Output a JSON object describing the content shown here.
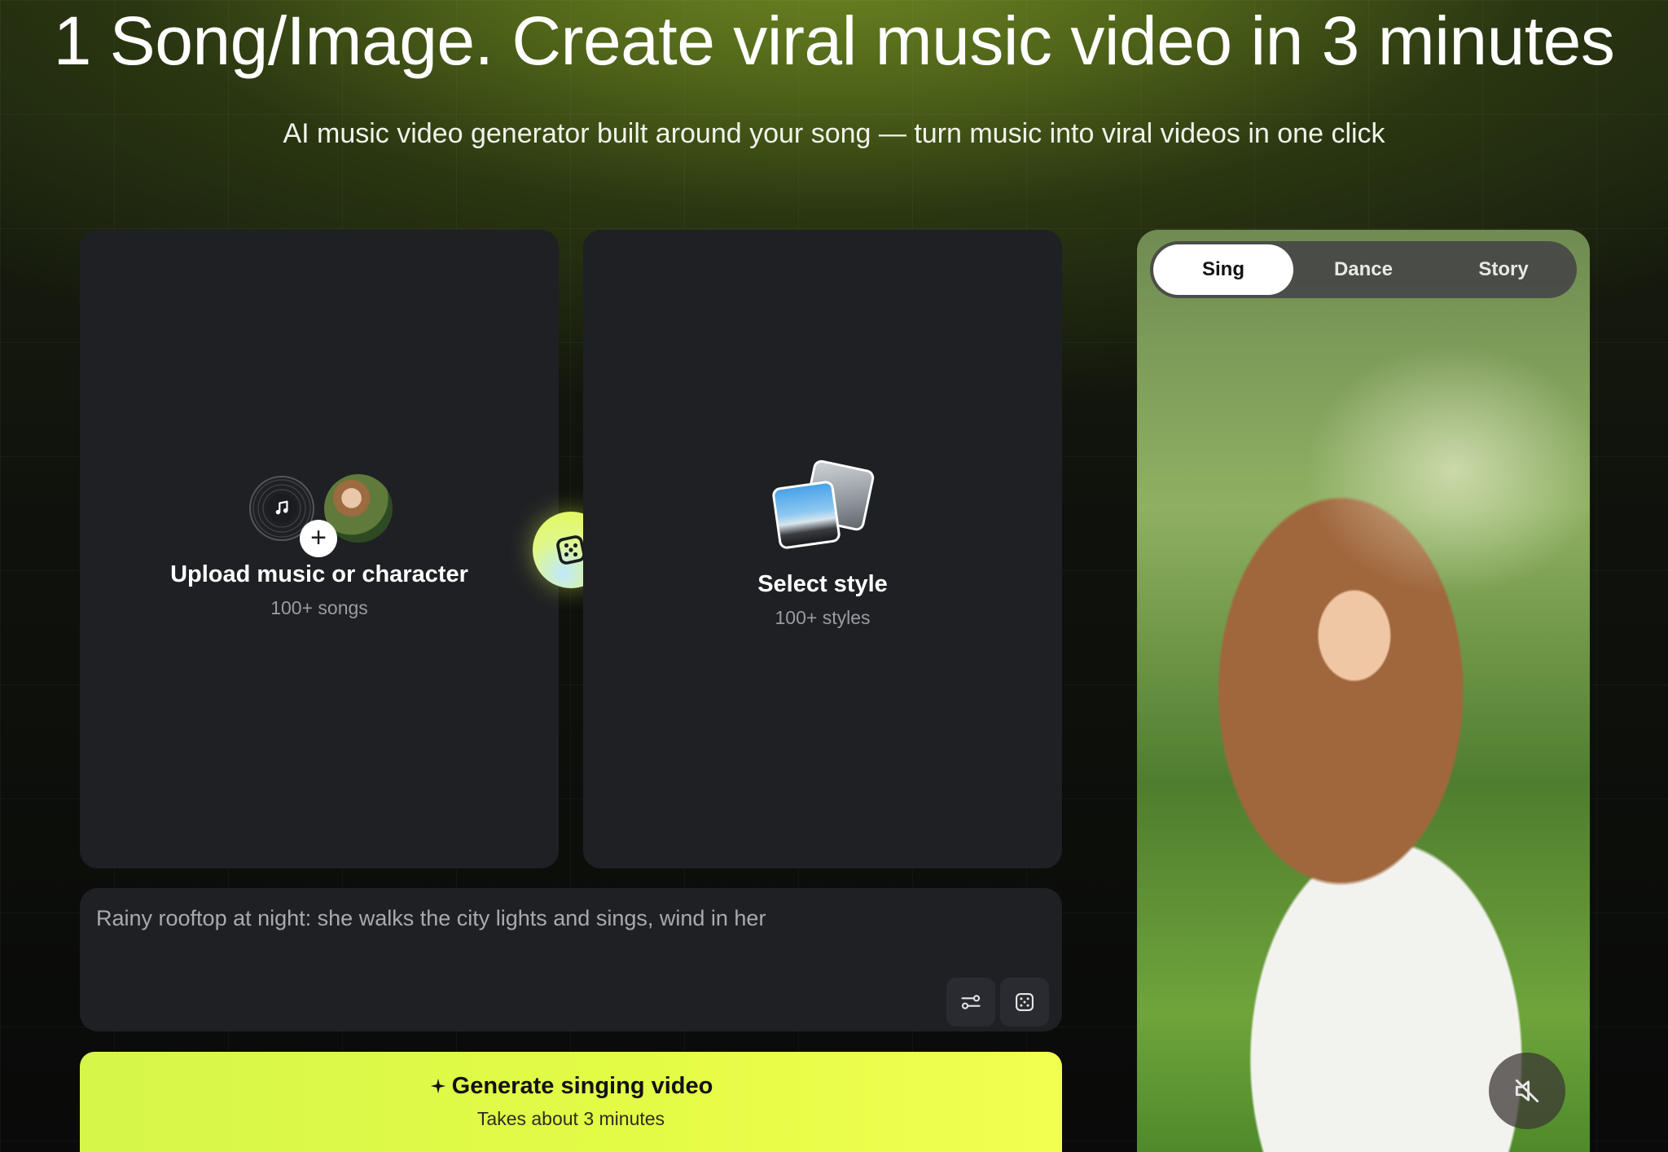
{
  "hero": {
    "title": "1 Song/Image. Create viral music video in 3 minutes",
    "subtitle": "AI music video generator built around your song — turn music into viral videos in one click"
  },
  "upload_card": {
    "title": "Upload music or character",
    "subtitle": "100+ songs",
    "icons": [
      "music-note-icon",
      "avatar",
      "plus-icon"
    ]
  },
  "randomize": {
    "icon": "dice-icon"
  },
  "style_card": {
    "title": "Select style",
    "subtitle": "100+ styles",
    "icon": "style-thumbnails"
  },
  "prompt": {
    "text": "Rainy rooftop at night: she walks the city lights and sings, wind in her",
    "icons": [
      "sliders-icon",
      "dice-icon"
    ]
  },
  "generate": {
    "label": "Generate singing video",
    "sublabel": "Takes about 3 minutes",
    "icon": "sparkle-icon"
  },
  "preview": {
    "tabs": [
      {
        "label": "Sing",
        "active": true
      },
      {
        "label": "Dance",
        "active": false
      },
      {
        "label": "Story",
        "active": false
      }
    ],
    "mute_icon": "speaker-muted-icon"
  },
  "colors": {
    "accent": "#e3fb45",
    "card_bg": "#1f2024",
    "tab_active_bg": "#ffffff"
  }
}
